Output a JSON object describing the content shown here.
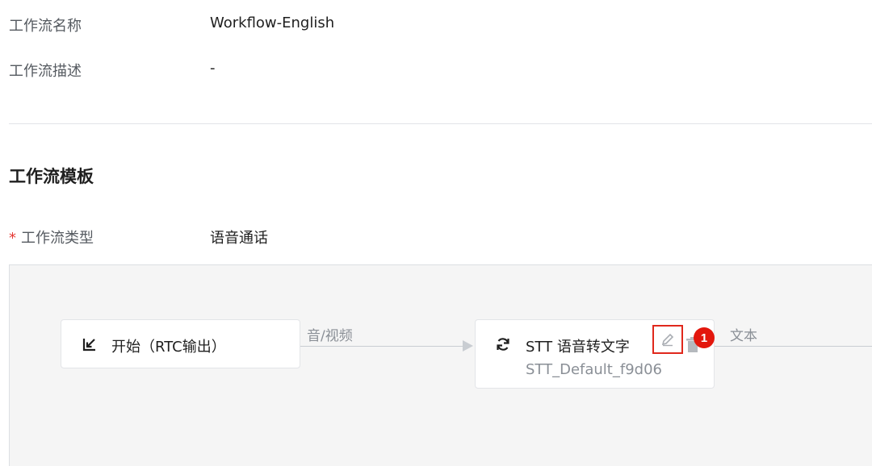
{
  "info": {
    "name_label": "工作流名称",
    "name_value": "Workflow-English",
    "desc_label": "工作流描述",
    "desc_value": "-"
  },
  "template": {
    "section_title": "工作流模板",
    "required_mark": "*",
    "type_label": "工作流类型",
    "type_value": "语音通话"
  },
  "flow": {
    "start_node": {
      "icon": "arrow-down-left-icon",
      "title": "开始（RTC输出）"
    },
    "edge_1_label": "音/视频",
    "stt_node": {
      "icon": "refresh-icon",
      "title": "STT 语音转文字",
      "subtitle": "STT_Default_f9d06",
      "edit_icon": "pencil-icon",
      "delete_icon": "trash-icon"
    },
    "badge": "1",
    "edge_2_label": "文本"
  },
  "colors": {
    "highlight": "#e0281c",
    "badge": "#e3170d",
    "canvas_bg": "#f5f5f5"
  }
}
